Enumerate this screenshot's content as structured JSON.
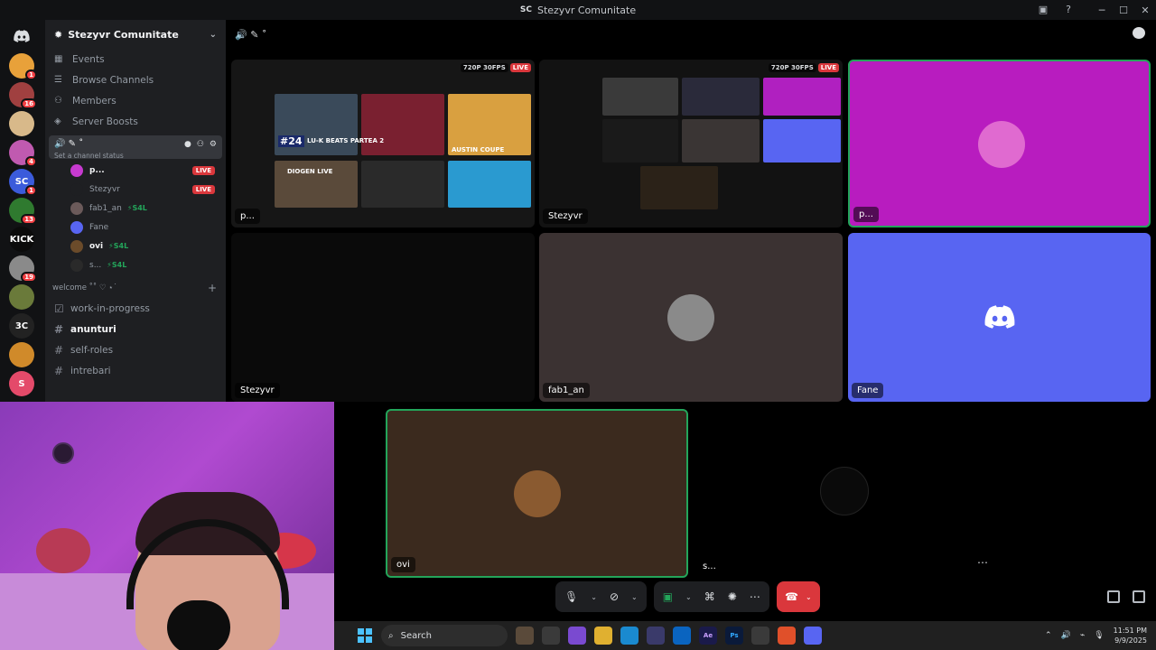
{
  "window": {
    "title": "Stezyvr Comunitate",
    "title_short": "SC"
  },
  "guild": {
    "name": "Stezyvr Comunitate",
    "nav": [
      {
        "label": "Events",
        "icon": "calendar-icon"
      },
      {
        "label": "Browse Channels",
        "icon": "browse-icon"
      },
      {
        "label": "Members",
        "icon": "members-icon"
      },
      {
        "label": "Server Boosts",
        "icon": "boost-icon"
      }
    ],
    "voice_channel": {
      "name": "🔊 ✎ ˚",
      "status_placeholder": "Set a channel status",
      "members": [
        {
          "name": "p...",
          "live": "LIVE",
          "color": "#c73ad0",
          "strong": true
        },
        {
          "name": "Stezyvr",
          "live": "LIVE",
          "color": "#1e1f22",
          "strong": false
        },
        {
          "name": "fab1_an",
          "badge": "⚡S4L",
          "color": "#6b5a5a",
          "strong": false
        },
        {
          "name": "Fane",
          "color": "#5865f2",
          "strong": false
        },
        {
          "name": "ovi",
          "badge": "⚡S4L",
          "color": "#6b4b2a",
          "strong": true
        },
        {
          "name": "s...",
          "badge": "⚡S4L",
          "color": "#2a2a2a",
          "strong": false
        }
      ]
    },
    "category": "welcome ˚˚ ♡ ⋆˙",
    "channels": [
      {
        "name": "work-in-progress",
        "icon": "☑",
        "bold": false
      },
      {
        "name": "anunturi",
        "icon": "#",
        "bold": true
      },
      {
        "name": "self-roles",
        "icon": "#",
        "bold": false
      },
      {
        "name": "intrebari",
        "icon": "#",
        "bold": false
      }
    ]
  },
  "servers": [
    {
      "badge": "1",
      "color": "#e8a13a",
      "label": ""
    },
    {
      "badge": "16",
      "color": "#a04040",
      "label": ""
    },
    {
      "badge": "",
      "color": "#d8b98a",
      "label": ""
    },
    {
      "badge": "4",
      "color": "#c05ab0",
      "label": ""
    },
    {
      "badge": "1",
      "color": "#3b5bdb",
      "label": "SC"
    },
    {
      "badge": "13",
      "color": "#2f7a2f",
      "label": ""
    },
    {
      "badge": "",
      "color": "#0b0b0b",
      "label": "KICK"
    },
    {
      "badge": "19",
      "color": "#8a8a8a",
      "label": ""
    },
    {
      "badge": "",
      "color": "#6a7a3a",
      "label": ""
    },
    {
      "badge": "",
      "color": "#222",
      "label": "3C"
    },
    {
      "badge": "",
      "color": "#d08a2a",
      "label": ""
    },
    {
      "badge": "",
      "color": "#e44a6a",
      "label": "S"
    }
  ],
  "stage": {
    "header": "🔊 ✎ ˚",
    "tiles": [
      {
        "name": "p...",
        "quality": "720P 30FPS",
        "live": "LIVE"
      },
      {
        "name": "Stezyvr",
        "quality": "720P 30FPS",
        "live": "LIVE"
      },
      {
        "name": "p..."
      },
      {
        "name": "Stezyvr"
      },
      {
        "name": "fab1_an"
      },
      {
        "name": "Fane"
      },
      {
        "name": "ovi"
      },
      {
        "name": "s..."
      }
    ],
    "stream_text": {
      "badge": "#24",
      "title1": "LU-K BEATS PARTEA 2",
      "title2": "AUSTIN COUPE",
      "title3": "DIOGEN LIVE"
    }
  },
  "taskbar": {
    "search": "Search",
    "time": "11:51 PM",
    "date": "9/9/2025"
  },
  "colors": {
    "accent": "#5865f2",
    "danger": "#da373c",
    "green": "#23a55a"
  }
}
